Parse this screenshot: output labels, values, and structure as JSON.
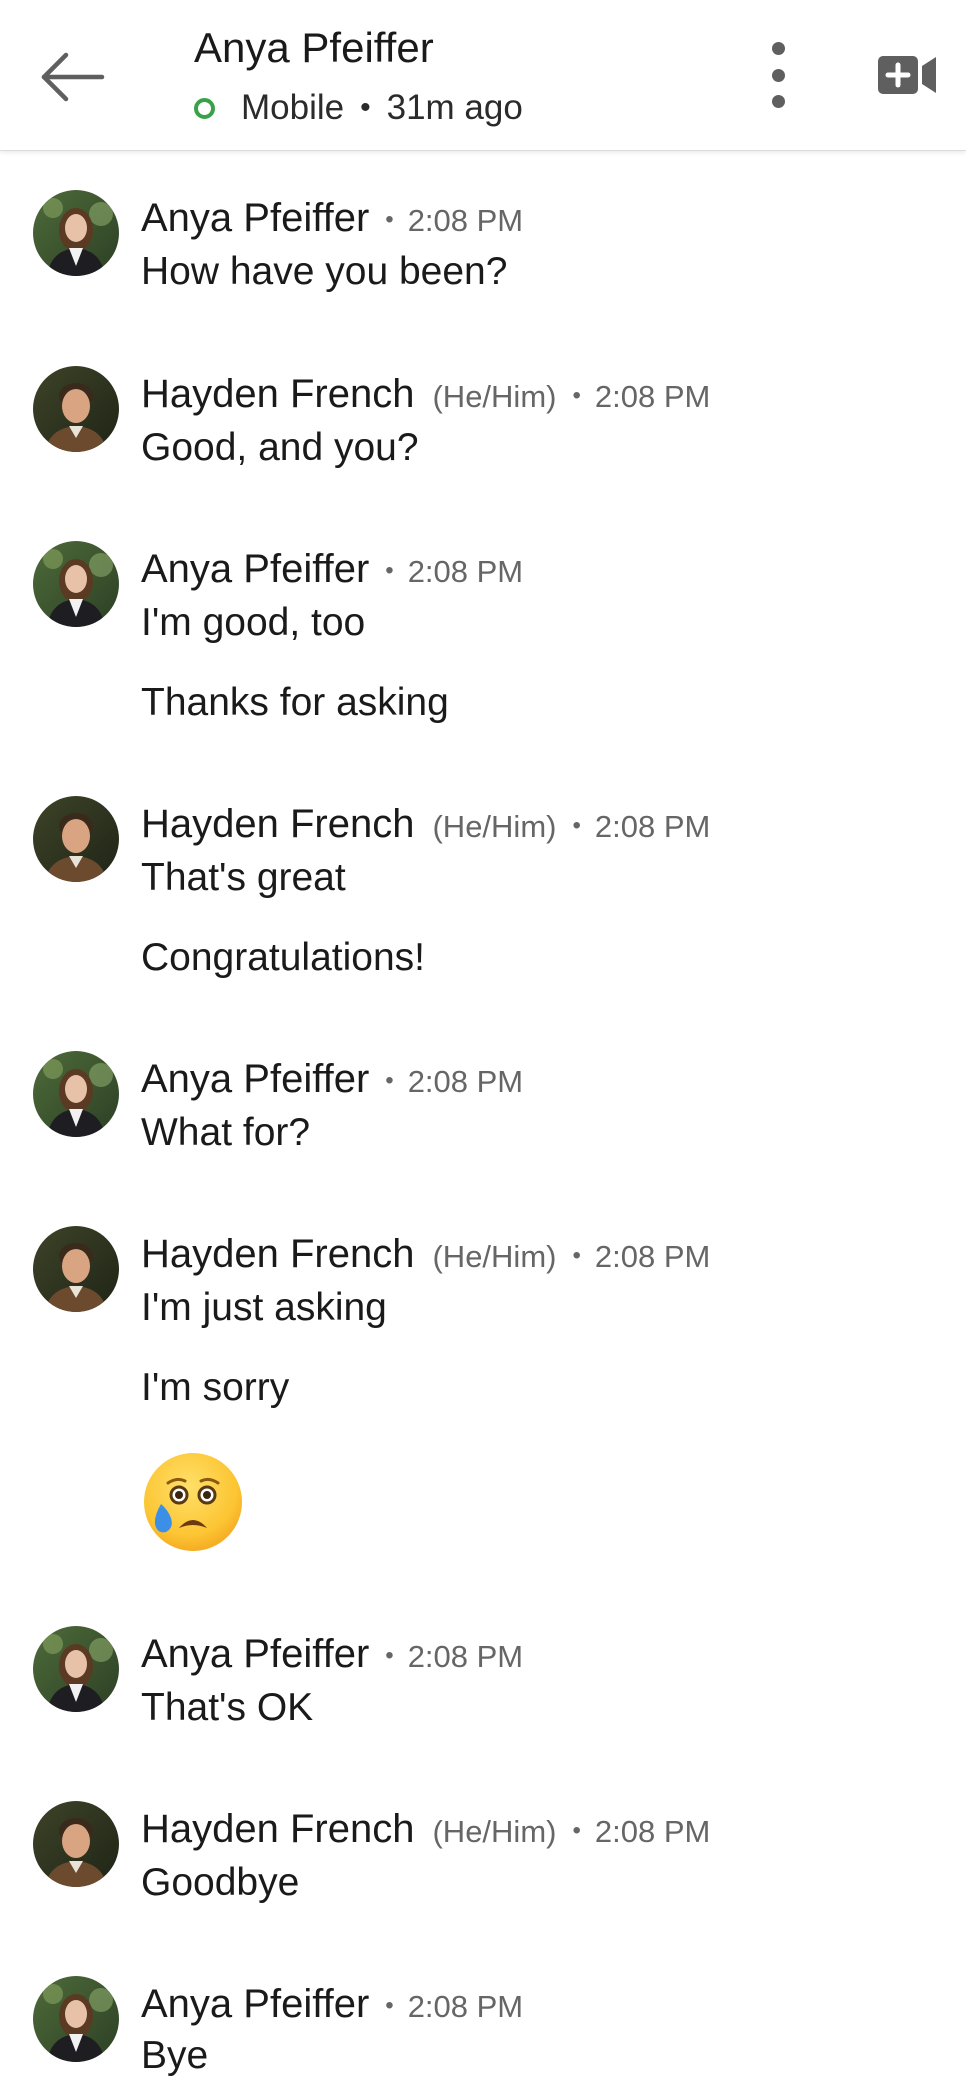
{
  "header": {
    "contact_name": "Anya Pfeiffer",
    "status": "Mobile",
    "last_seen": "31m ago",
    "separator": "•"
  },
  "icons": {
    "back": "arrow-left-icon",
    "more": "more-vertical-icon",
    "video": "video-call-add-icon",
    "presence": "online-status-icon"
  },
  "colors": {
    "presence": "#3aa04a",
    "text": "#1a1a1a",
    "meta": "#666666",
    "icon": "#5f5f5f"
  },
  "messages": [
    {
      "sender": "Anya Pfeiffer",
      "pronouns": "",
      "time": "2:08 PM",
      "lines": [
        "How have you been?"
      ]
    },
    {
      "sender": "Hayden French",
      "pronouns": "(He/Him)",
      "time": "2:08 PM",
      "lines": [
        "Good, and you?"
      ]
    },
    {
      "sender": "Anya Pfeiffer",
      "pronouns": "",
      "time": "2:08 PM",
      "lines": [
        "I'm good, too",
        "Thanks for asking"
      ]
    },
    {
      "sender": "Hayden French",
      "pronouns": "(He/Him)",
      "time": "2:08 PM",
      "lines": [
        "That's great",
        "Congratulations!"
      ]
    },
    {
      "sender": "Anya Pfeiffer",
      "pronouns": "",
      "time": "2:08 PM",
      "lines": [
        "What for?"
      ]
    },
    {
      "sender": "Hayden French",
      "pronouns": "(He/Him)",
      "time": "2:08 PM",
      "lines": [
        "I'm just asking",
        "I'm sorry"
      ],
      "emoji": "crying-face-emoji"
    },
    {
      "sender": "Anya Pfeiffer",
      "pronouns": "",
      "time": "2:08 PM",
      "lines": [
        "That's OK"
      ]
    },
    {
      "sender": "Hayden French",
      "pronouns": "(He/Him)",
      "time": "2:08 PM",
      "lines": [
        "Goodbye"
      ]
    },
    {
      "sender": "Anya Pfeiffer",
      "pronouns": "",
      "time": "2:08 PM",
      "lines": [
        "Bye"
      ]
    }
  ]
}
